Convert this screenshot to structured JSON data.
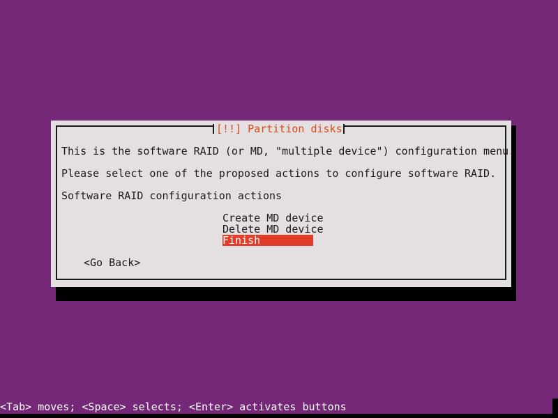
{
  "screen": {
    "background_color": "#752878",
    "text_color": "#ffffff"
  },
  "dialog": {
    "title": "[!!] Partition disks",
    "title_color": "#dd4814",
    "background_color": "#e4e0e2",
    "border_color": "#1a1a1a",
    "body_lines": [
      "This is the software RAID (or MD, \"multiple device\") configuration menu.",
      "Please select one of the proposed actions to configure software RAID.",
      "Software RAID configuration actions"
    ],
    "menu": {
      "selected_index": 2,
      "highlight_color": "#e03c28",
      "items": [
        {
          "label": "Create MD device"
        },
        {
          "label": "Delete MD device"
        },
        {
          "label": "Finish"
        }
      ]
    },
    "buttons": [
      {
        "label": "<Go Back>"
      }
    ]
  },
  "footer": {
    "help_text": "<Tab> moves; <Space> selects; <Enter> activates buttons"
  }
}
